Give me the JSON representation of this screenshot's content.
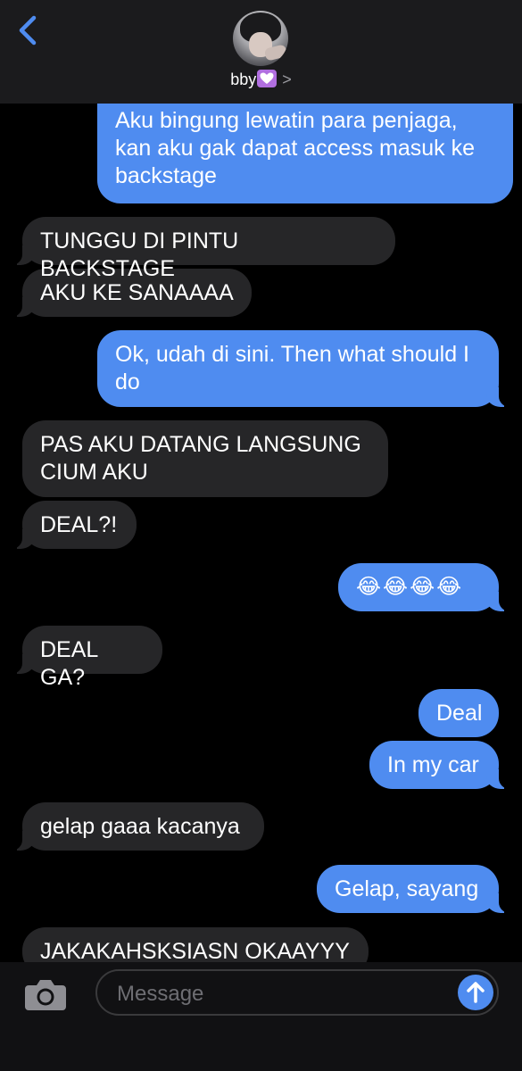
{
  "header": {
    "contact_name": "bby",
    "back_icon": "chevron-left-icon",
    "heart_icon": "white-heart-on-purple-emoji",
    "detail_icon": "chevron-right-icon",
    "chevron_glyph": ">"
  },
  "messages": [
    {
      "dir": "out",
      "text": "Aku bingung lewatin para penjaga, kan aku gak dapat access masuk ke backstage"
    },
    {
      "dir": "in",
      "text": "TUNGGU DI PINTU BACKSTAGE"
    },
    {
      "dir": "in",
      "text": "AKU KE SANAAAA"
    },
    {
      "dir": "out",
      "text": "Ok, udah di sini. Then what should I do"
    },
    {
      "dir": "in",
      "text": "PAS AKU DATANG LANGSUNG CIUM AKU"
    },
    {
      "dir": "in",
      "text": "DEAL?!"
    },
    {
      "dir": "out",
      "text": "😂😂😂😂"
    },
    {
      "dir": "in",
      "text": "DEAL GA?"
    },
    {
      "dir": "out",
      "text": "Deal"
    },
    {
      "dir": "out",
      "text": "In my car"
    },
    {
      "dir": "in",
      "text": "gelap gaaa kacanya"
    },
    {
      "dir": "out",
      "text": "Gelap, sayang"
    },
    {
      "dir": "in",
      "text": "JAKAKAHSKSIASN OKAAYYY"
    }
  ],
  "input": {
    "placeholder": "Message",
    "camera_icon": "camera-icon",
    "send_icon": "send-arrow-up-icon"
  },
  "colors": {
    "outgoing_bubble": "#4f8cf0",
    "incoming_bubble": "#262628",
    "background": "#000000",
    "header": "#1b1b1d",
    "heart_bg": "#b16fe0"
  }
}
